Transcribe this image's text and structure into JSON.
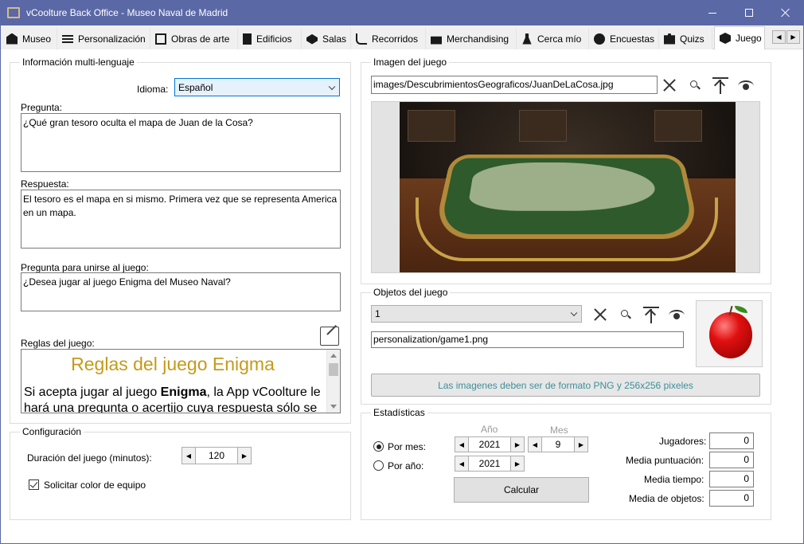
{
  "window": {
    "title": "vCoolture Back Office - Museo Naval de Madrid"
  },
  "tabs": [
    {
      "label": "Museo",
      "icon": "house-icon"
    },
    {
      "label": "Personalización",
      "icon": "sliders-icon"
    },
    {
      "label": "Obras de arte",
      "icon": "picture-icon"
    },
    {
      "label": "Edificios",
      "icon": "building-icon"
    },
    {
      "label": "Salas",
      "icon": "room-icon"
    },
    {
      "label": "Recorridos",
      "icon": "route-icon"
    },
    {
      "label": "Merchandising",
      "icon": "gift-icon"
    },
    {
      "label": "Cerca mío",
      "icon": "person-location-icon"
    },
    {
      "label": "Encuestas",
      "icon": "question-icon"
    },
    {
      "label": "Quizs",
      "icon": "puzzle-icon"
    },
    {
      "label": "Juego",
      "icon": "dice-icon",
      "active": true
    }
  ],
  "multilang": {
    "group_title": "Información multi-lenguaje",
    "idioma_label": "Idioma:",
    "idioma_value": "Español",
    "pregunta_label": "Pregunta:",
    "pregunta_value": "¿Qué gran tesoro oculta el mapa de Juan de la Cosa?",
    "respuesta_label": "Respuesta:",
    "respuesta_value": "El tesoro es el mapa en si mismo. Primera vez que se representa America en un mapa.",
    "unirse_label": "Pregunta para unirse al juego:",
    "unirse_value": "¿Desea jugar al juego Enigma del Museo Naval?",
    "reglas_label": "Reglas del juego:",
    "reglas_title": "Reglas del juego Enigma",
    "reglas_body_pre": "Si acepta jugar al juego ",
    "reglas_body_bold": "Enigma",
    "reglas_body_post": ", la App vCoolture le hará una pregunta o acertijo cuya respuesta sólo se"
  },
  "config": {
    "group_title": "Configuración",
    "duracion_label": "Duración del juego (minutos):",
    "duracion_value": "120",
    "color_label": "Solicitar color de equipo",
    "color_checked": true
  },
  "imagen": {
    "group_title": "Imagen del juego",
    "path": "images/DescubrimientosGeograficos/JuanDeLaCosa.jpg"
  },
  "objetos": {
    "group_title": "Objetos del juego",
    "selected": "1",
    "path": "personalization/game1.png",
    "notice": "Las imagenes deben ser de formato PNG y 256x256 pixeles"
  },
  "stats": {
    "group_title": "Estadísticas",
    "anio_header": "Año",
    "mes_header": "Mes",
    "por_mes_label": "Por mes:",
    "por_anio_label": "Por año:",
    "por_mes_year": "2021",
    "por_mes_month": "9",
    "por_anio_year": "2021",
    "calcular": "Calcular",
    "jugadores_label": "Jugadores:",
    "jugadores_value": "0",
    "media_puntuacion_label": "Media puntuación:",
    "media_puntuacion_value": "0",
    "media_tiempo_label": "Media tiempo:",
    "media_tiempo_value": "0",
    "media_objetos_label": "Media de objetos:",
    "media_objetos_value": "0"
  },
  "colors": {
    "titlebar": "#5b68a6",
    "rules_title": "#c49a1a",
    "notice_text": "#3d8f99"
  }
}
